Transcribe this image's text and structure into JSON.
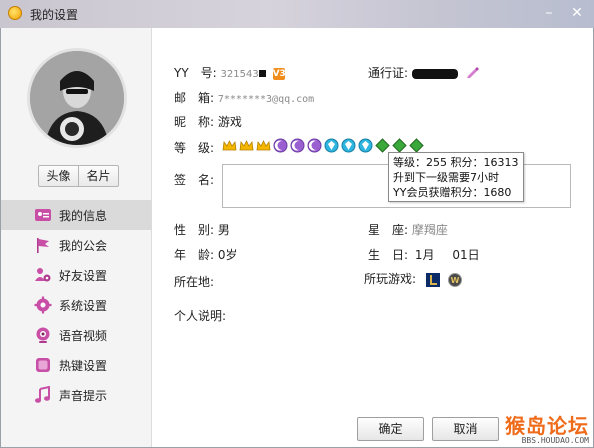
{
  "window": {
    "title": "我的设置",
    "minimize": "–",
    "close": "✕"
  },
  "sidebar": {
    "avatar_button": "头像",
    "card_button": "名片",
    "items": [
      {
        "label": "我的信息",
        "icon": "profile-card-icon"
      },
      {
        "label": "我的公会",
        "icon": "flag-icon"
      },
      {
        "label": "好友设置",
        "icon": "friends-gear-icon"
      },
      {
        "label": "系统设置",
        "icon": "gear-icon"
      },
      {
        "label": "语音视频",
        "icon": "webcam-icon"
      },
      {
        "label": "热键设置",
        "icon": "hotkey-icon"
      },
      {
        "label": "声音提示",
        "icon": "music-note-icon"
      }
    ]
  },
  "profile": {
    "yy_label": "YY　号:",
    "yy_value": "321543",
    "vip_badge": "V3",
    "pass_label": "通行证:",
    "email_label": "邮　箱:",
    "email_value": "7*******3@qq.com",
    "nick_label": "昵　称:",
    "nick_value": "游戏",
    "level_label": "等　级:",
    "sign_label": "签　名:",
    "gender_label": "性　别:",
    "gender_value": "男",
    "constellation_label": "星　座:",
    "constellation_value": "摩羯座",
    "age_label": "年　龄:",
    "age_value": "0岁",
    "birthday_label": "生　日:",
    "birthday_month": "1月",
    "birthday_day": "01日",
    "location_label": "所在地:",
    "games_label": "所玩游戏:",
    "intro_label": "个人说明:"
  },
  "tooltip": {
    "line1": "等级：255 积分：16313",
    "line2": "升到下一级需要7小时",
    "line3": "YY会员获赠积分：1680"
  },
  "footer": {
    "ok_label": "确定",
    "cancel_label": "取消",
    "watermark_logo": "猴岛论坛",
    "watermark_url": "BBS.HOUDAO.COM"
  },
  "colors": {
    "accent": "#f08d1b",
    "active_menu": "#dadada"
  }
}
